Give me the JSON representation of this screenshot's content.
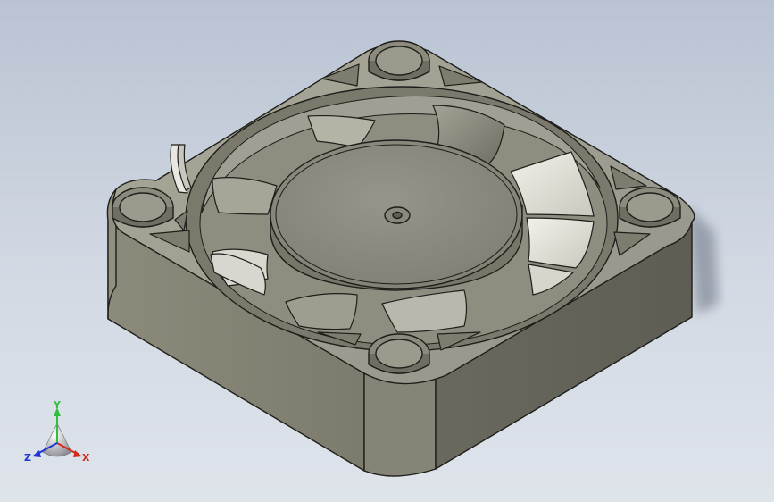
{
  "viewport": {
    "model_name": "fan",
    "colors": {
      "background_top": "#b9c3d2",
      "background_bottom": "#dfe4eb",
      "body_top": "#9d9c8c",
      "body_side_dark": "#6e6d62",
      "body_side_light": "#8d8c7d",
      "hub": "#8e8d7f",
      "blade_light": "#e6e5dd",
      "blade_dark": "#8c8b7e",
      "edge": "#1e1e1a"
    }
  },
  "triad": {
    "x_label": "X",
    "y_label": "Y",
    "z_label": "Z",
    "x_color": "#d42a1e",
    "y_color": "#2fbf3a",
    "z_color": "#2036d4"
  }
}
